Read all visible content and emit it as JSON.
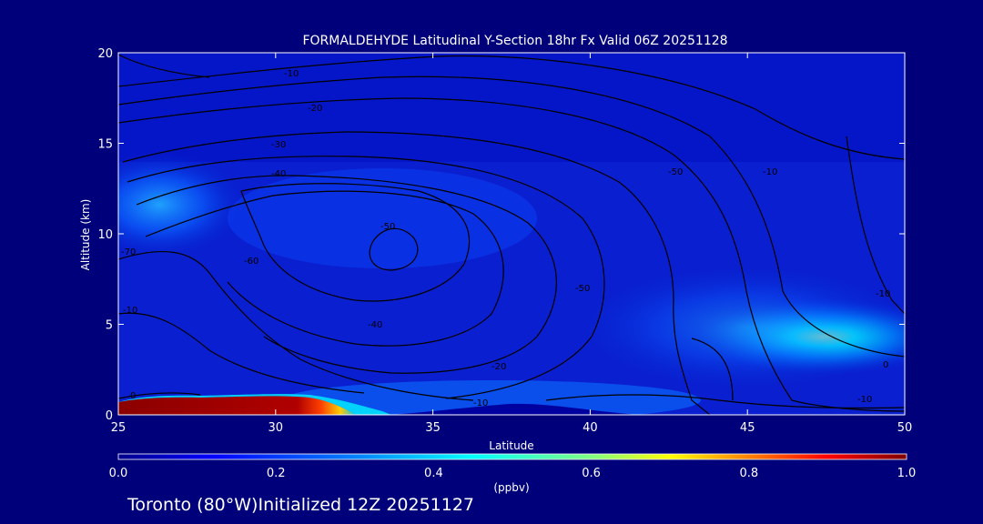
{
  "chart_data": {
    "type": "heatmap",
    "title": "FORMALDEHYDE Latitudinal Y-Section 18hr  Fx Valid 06Z 20251128",
    "xlabel": "Latitude",
    "ylabel": "Altitude (km)",
    "xlim": [
      25,
      50
    ],
    "ylim": [
      0,
      20
    ],
    "x_ticks": [
      "25",
      "30",
      "35",
      "40",
      "45",
      "50"
    ],
    "y_ticks": [
      "0",
      "5",
      "10",
      "15",
      "20"
    ],
    "colorbar": {
      "min": 0.0,
      "max": 1.0,
      "ticks": [
        "0.0",
        "0.2",
        "0.4",
        "0.6",
        "0.8",
        "1.0"
      ],
      "unit": "(ppbv)",
      "colors": [
        "#00008b",
        "#0000ff",
        "#0080ff",
        "#00ffff",
        "#80ff80",
        "#ffff00",
        "#ff8000",
        "#ff0000",
        "#800000"
      ]
    },
    "field_features": [
      {
        "lat_range": [
          25,
          31.5
        ],
        "alt_range": [
          0,
          0.9
        ],
        "value": 1.0
      },
      {
        "lat_range": [
          31.5,
          33.5
        ],
        "alt_range": [
          0,
          0.8
        ],
        "value": 0.7
      },
      {
        "lat_range": [
          25,
          28
        ],
        "alt_range": [
          10.5,
          13.5
        ],
        "value": 0.35
      },
      {
        "lat_range": [
          43,
          50
        ],
        "alt_range": [
          3,
          6
        ],
        "value": 0.5
      },
      {
        "lat_range": [
          33,
          43
        ],
        "alt_range": [
          0.3,
          1.2
        ],
        "value": 0.25
      }
    ],
    "contour_labels": [
      "-10",
      "-20",
      "-30",
      "-40",
      "-50",
      "-60",
      "-70",
      "-10",
      "-20",
      "-40",
      "-50",
      "-50",
      "-10",
      "-10",
      "-10",
      "-10",
      "0",
      "0"
    ]
  },
  "footer": {
    "location_text": "Toronto (80°W)Initialized 12Z 20251127"
  }
}
